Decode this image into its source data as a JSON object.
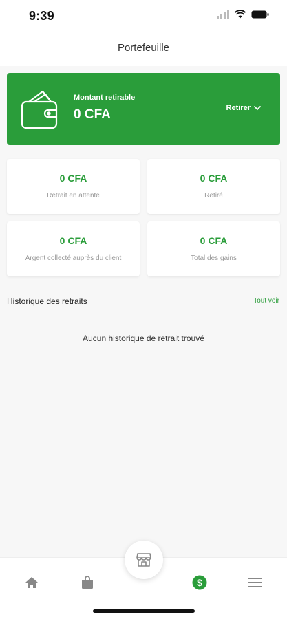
{
  "status_bar": {
    "time": "9:39"
  },
  "header": {
    "title": "Portefeuille"
  },
  "balance": {
    "label": "Montant retirable",
    "value": "0 CFA",
    "withdraw_label": "Retirer"
  },
  "stats": [
    {
      "value": "0 CFA",
      "label": "Retrait en attente"
    },
    {
      "value": "0 CFA",
      "label": "Retiré"
    },
    {
      "value": "0 CFA",
      "label": "Argent collecté auprès du client"
    },
    {
      "value": "0 CFA",
      "label": "Total des gains"
    }
  ],
  "history": {
    "title": "Historique des retraits",
    "see_all": "Tout voir",
    "empty": "Aucun historique de retrait trouvé"
  },
  "nav": {
    "items": [
      "home-icon",
      "shopping-bag-icon",
      "store-icon",
      "dollar-icon",
      "menu-icon"
    ],
    "active": "dollar-icon"
  },
  "colors": {
    "accent": "#2a9d3a",
    "inactive": "#888888"
  }
}
